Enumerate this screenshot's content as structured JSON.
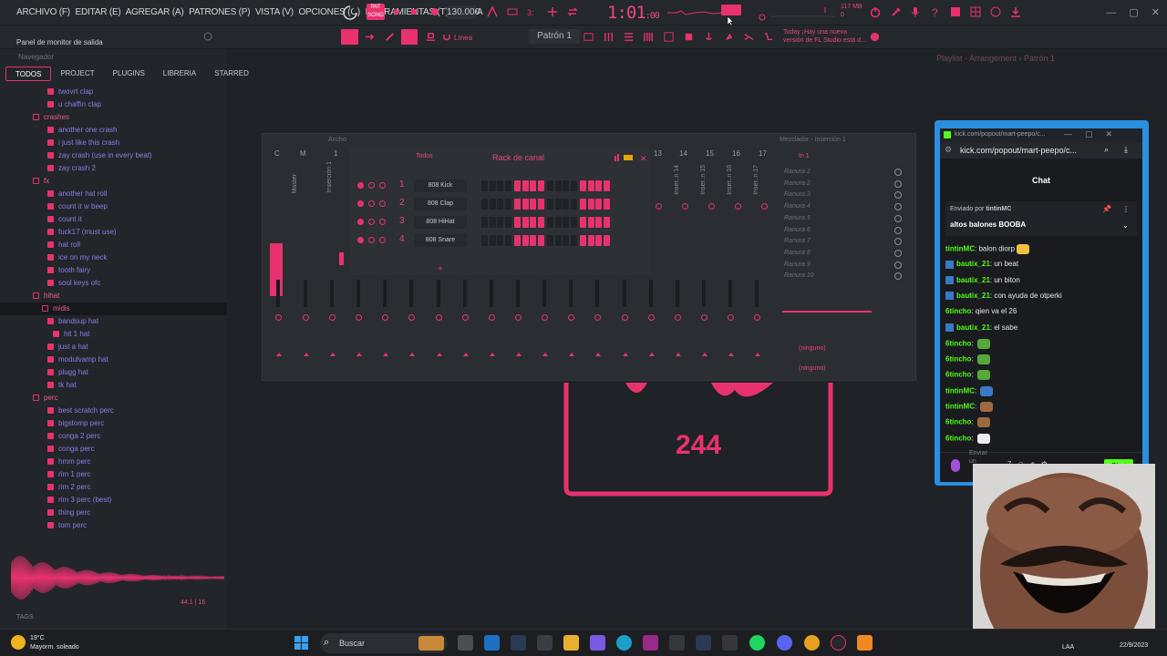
{
  "menubar": {
    "items": [
      "ARCHIVO (F)",
      "EDITAR (E)",
      "AGREGAR (A)",
      "PATRONES (P)",
      "VISTA (V)",
      "OPCIONES (O)",
      "HERRAMIENTAS (T)",
      "AYUDA"
    ],
    "bpm": "130.000",
    "time": "1:01",
    "time_small": ":00",
    "memory": "117 MB",
    "memory_sub": "0"
  },
  "toolbar": {
    "hint": "Panel de monitor de salida",
    "snap": "Línea",
    "pattern": "Patrón 1",
    "news_line1": "Today ¡Hay una nueva",
    "news_line2": "versión de FL Studio está d..."
  },
  "browser": {
    "title": "Navegador",
    "tabs": [
      "TODOS",
      "PROJECT",
      "PLUGINS",
      "LIBRERIA",
      "STARRED"
    ],
    "rows": [
      {
        "label": "twovrt clap",
        "type": "file",
        "indent": 1
      },
      {
        "label": "u chaffin clap",
        "type": "file",
        "indent": 1
      },
      {
        "label": "crashes",
        "type": "folder",
        "indent": 0
      },
      {
        "label": "another one crash",
        "type": "file",
        "indent": 1
      },
      {
        "label": "i just like this crash",
        "type": "file",
        "indent": 1
      },
      {
        "label": "zay crash (use in every beat)",
        "type": "file",
        "indent": 1
      },
      {
        "label": "zay crash 2",
        "type": "file",
        "indent": 1
      },
      {
        "label": "fx",
        "type": "folder",
        "indent": 0
      },
      {
        "label": "another hat roll",
        "type": "file",
        "indent": 1
      },
      {
        "label": "count it w beep",
        "type": "file",
        "indent": 1
      },
      {
        "label": "count it",
        "type": "file",
        "indent": 1
      },
      {
        "label": "fuck17 (must use)",
        "type": "file",
        "indent": 1
      },
      {
        "label": "hat roll",
        "type": "file",
        "indent": 1
      },
      {
        "label": "ice on my neck",
        "type": "file",
        "indent": 1
      },
      {
        "label": "tooth fairy",
        "type": "file",
        "indent": 1
      },
      {
        "label": "sool keys ofc",
        "type": "file",
        "indent": 1
      },
      {
        "label": "hihat",
        "type": "folder",
        "indent": 0
      },
      {
        "label": "midis",
        "type": "folder",
        "indent": 1
      },
      {
        "label": "bandsup hat",
        "type": "file",
        "indent": 1
      },
      {
        "label": "hit 1 hat",
        "type": "file",
        "indent": 2
      },
      {
        "label": "just a hat",
        "type": "file",
        "indent": 1
      },
      {
        "label": "modulvamp hat",
        "type": "file",
        "indent": 1
      },
      {
        "label": "plugg hat",
        "type": "file",
        "indent": 1
      },
      {
        "label": "tk hat",
        "type": "file",
        "indent": 1
      },
      {
        "label": "perc",
        "type": "folder",
        "indent": 0
      },
      {
        "label": "best scratch perc",
        "type": "file",
        "indent": 1
      },
      {
        "label": "bigstomp perc",
        "type": "file",
        "indent": 1
      },
      {
        "label": "conga 2 perc",
        "type": "file",
        "indent": 1
      },
      {
        "label": "conga perc",
        "type": "file",
        "indent": 1
      },
      {
        "label": "hmm perc",
        "type": "file",
        "indent": 1
      },
      {
        "label": "rim 1 perc",
        "type": "file",
        "indent": 1
      },
      {
        "label": "rim 2 perc",
        "type": "file",
        "indent": 1
      },
      {
        "label": "rim 3 perc (best)",
        "type": "file",
        "indent": 1
      },
      {
        "label": "thing perc",
        "type": "file",
        "indent": 1
      },
      {
        "label": "tom perc",
        "type": "file",
        "indent": 1
      }
    ],
    "sample_info": "44.1",
    "sample_bits": "16",
    "tags_label": "TAGS"
  },
  "mixer": {
    "title": "Ancho",
    "insert_title": "Mezclador - Inserción 1",
    "col_labels": [
      "C",
      "M",
      "1"
    ],
    "track_numbers": [
      "13",
      "14",
      "15",
      "16",
      "17"
    ],
    "strip_master": "Master",
    "strip_insert": "Inserción 1",
    "strip_labels_right": [
      "Inser..n 14",
      "Inser..n 15",
      "Inser..n 16",
      "Inser..n 17"
    ],
    "input": "In 1",
    "slots": [
      "Ranura 2",
      "Ranura 2",
      "Ranura 3",
      "Ranura 4",
      "Ranura 5",
      "Ranura 6",
      "Ranura 7",
      "Ranura 8",
      "Ranura 9",
      "Ranura 10"
    ],
    "send1": "(ninguno)",
    "send2": "(ninguno)"
  },
  "rack": {
    "title": "Rack de canal",
    "filter": "Todos",
    "channels": [
      {
        "num": "1",
        "name": "808 Kick"
      },
      {
        "num": "2",
        "name": "808 Clap"
      },
      {
        "num": "3",
        "name": "808 HiHat"
      },
      {
        "num": "4",
        "name": "808 Snare"
      }
    ],
    "add_label": "+"
  },
  "center": {
    "count": "244"
  },
  "playlist": {
    "title": "Playlist - Arrangement › Patrón 1"
  },
  "chat": {
    "tab_url": "kick.com/popout/mart-peepo/c...",
    "address": "kick.com/popout/mart-peepo/c...",
    "header": "Chat",
    "pinned_by_prefix": "Enviado por",
    "pinned_by": "tintinMC",
    "pinned_text": "altos balones BOOBA",
    "messages": [
      {
        "user": "tintinMC",
        "text": "balon diorp",
        "color": "green",
        "badge": false
      },
      {
        "user": "bautix_21",
        "text": "un beat",
        "color": "green",
        "badge": true
      },
      {
        "user": "bautix_21",
        "text": "un biton",
        "color": "green",
        "badge": true
      },
      {
        "user": "bautix_21",
        "text": "con ayuda de otperki",
        "color": "green",
        "badge": true
      },
      {
        "user": "6tincho",
        "text": "qien va el 26",
        "color": "green",
        "badge": false
      },
      {
        "user": "bautix_21",
        "text": "el sabe",
        "color": "green",
        "badge": true
      },
      {
        "user": "6tincho",
        "text": "",
        "color": "green",
        "badge": false
      },
      {
        "user": "6tincho",
        "text": "",
        "color": "green",
        "badge": false
      },
      {
        "user": "6tincho",
        "text": "",
        "color": "green",
        "badge": false
      },
      {
        "user": "tintinMC",
        "text": "",
        "color": "green",
        "badge": false
      },
      {
        "user": "tintinMC",
        "text": "",
        "color": "green",
        "badge": false
      },
      {
        "user": "6tincho",
        "text": "",
        "color": "green",
        "badge": false
      },
      {
        "user": "6tincho",
        "text": "",
        "color": "green",
        "badge": false
      }
    ],
    "input_placeholder": "Enviar un",
    "send_button": "Chat"
  },
  "taskbar": {
    "temperature": "19°C",
    "weather": "Mayorm. soleado",
    "search": "Buscar",
    "lang": "LAA",
    "date": "22/9/2023"
  },
  "colors": {
    "accent": "#e8326e",
    "kick_green": "#53fc18",
    "chat_border": "#2a8fe0"
  }
}
